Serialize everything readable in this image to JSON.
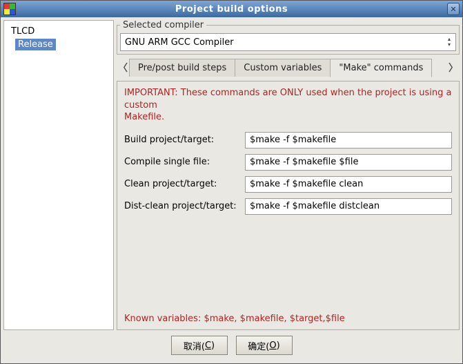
{
  "window": {
    "title": "Project build options"
  },
  "sidebar": {
    "root": "TLCD",
    "child": "Release"
  },
  "compiler": {
    "legend": "Selected compiler",
    "value": "GNU ARM GCC Compiler"
  },
  "tabs": {
    "prepost": "Pre/post build steps",
    "customvars": "Custom variables",
    "make": "\"Make\" commands"
  },
  "make": {
    "warning_line1": "IMPORTANT: These commands are ONLY used when the project is using a custom",
    "warning_line2": "Makefile.",
    "labels": {
      "build": "Build project/target:",
      "compile": "Compile single file:",
      "clean": "Clean project/target:",
      "distclean": "Dist-clean project/target:"
    },
    "values": {
      "build": "$make -f $makefile",
      "compile": "$make -f $makefile $file",
      "clean": "$make -f $makefile clean",
      "distclean": "$make -f $makefile distclean"
    },
    "known_vars": "Known variables: $make, $makefile, $target,$file"
  },
  "buttons": {
    "cancel_pre": "取消(",
    "cancel_key": "C",
    "cancel_post": ")",
    "ok_pre": "确定(",
    "ok_key": "O",
    "ok_post": ")"
  }
}
